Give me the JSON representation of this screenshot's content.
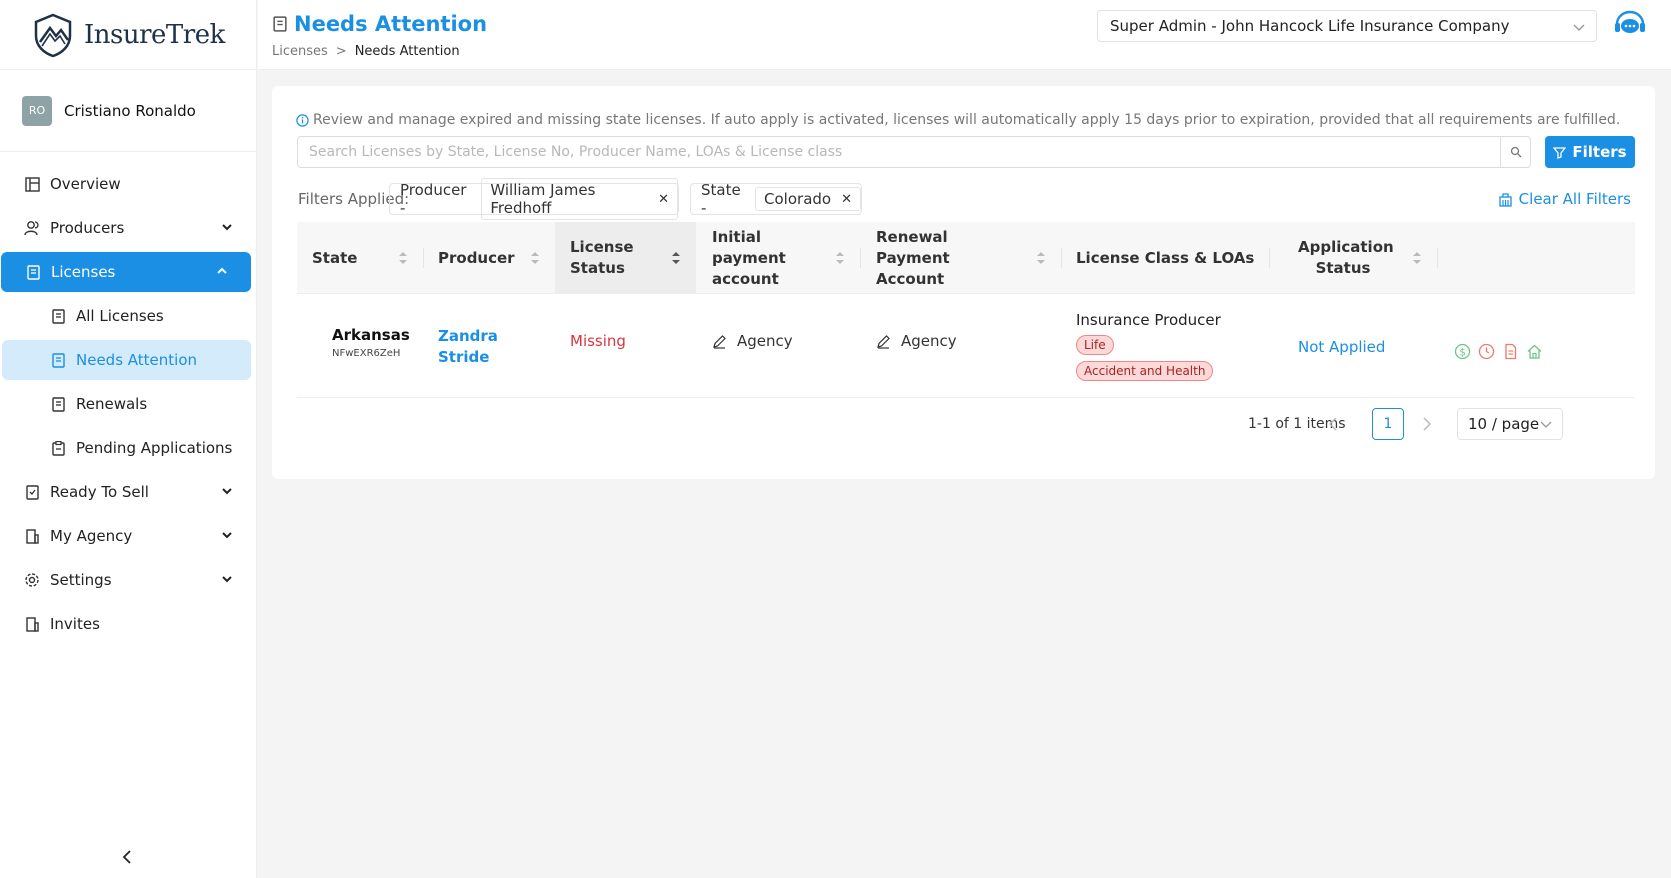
{
  "brand": {
    "name": "InsureTrek",
    "accent": "#1a8fe3"
  },
  "user": {
    "initials": "RO",
    "name": "Cristiano Ronaldo"
  },
  "nav": {
    "overview": "Overview",
    "producers": "Producers",
    "licenses": "Licenses",
    "licenses_sub": {
      "all": "All Licenses",
      "needs_attention": "Needs Attention",
      "renewals": "Renewals",
      "pending": "Pending Applications"
    },
    "ready_to_sell": "Ready To Sell",
    "my_agency": "My Agency",
    "settings": "Settings",
    "invites": "Invites"
  },
  "header": {
    "title": "Needs Attention",
    "breadcrumb": [
      "Licenses",
      "Needs Attention"
    ],
    "company": "Super Admin - John Hancock Life Insurance Company"
  },
  "main": {
    "info": "Review and manage expired and missing state licenses. If auto apply is activated, licenses will automatically apply 15 days prior to expiration, provided that all requirements are fulfilled.",
    "search_placeholder": "Search Licenses by State, License No, Producer Name, LOAs & License class",
    "filters_label": "Filters",
    "filters_applied_label": "Filters Applied:",
    "chips": [
      {
        "key": "Producer -",
        "value": "William James Fredhoff"
      },
      {
        "key": "State -",
        "value": "Colorado"
      }
    ],
    "clear_all": "Clear All Filters"
  },
  "table": {
    "columns": [
      "State",
      "Producer",
      "License Status",
      "Initial payment account",
      "Renewal Payment Account",
      "License Class & LOAs",
      "Application Status"
    ],
    "rows": [
      {
        "state": "Arkansas",
        "state_code": "NFwEXR6ZeH",
        "producer": "Zandra Stride",
        "license_status": "Missing",
        "initial_account": "Agency",
        "renewal_account": "Agency",
        "license_class": "Insurance Producer",
        "loas": [
          "Life",
          "Accident and Health"
        ],
        "application_status": "Not Applied"
      }
    ]
  },
  "pagination": {
    "info": "1-1 of 1 items",
    "current": "1",
    "page_size": "10 / page"
  }
}
